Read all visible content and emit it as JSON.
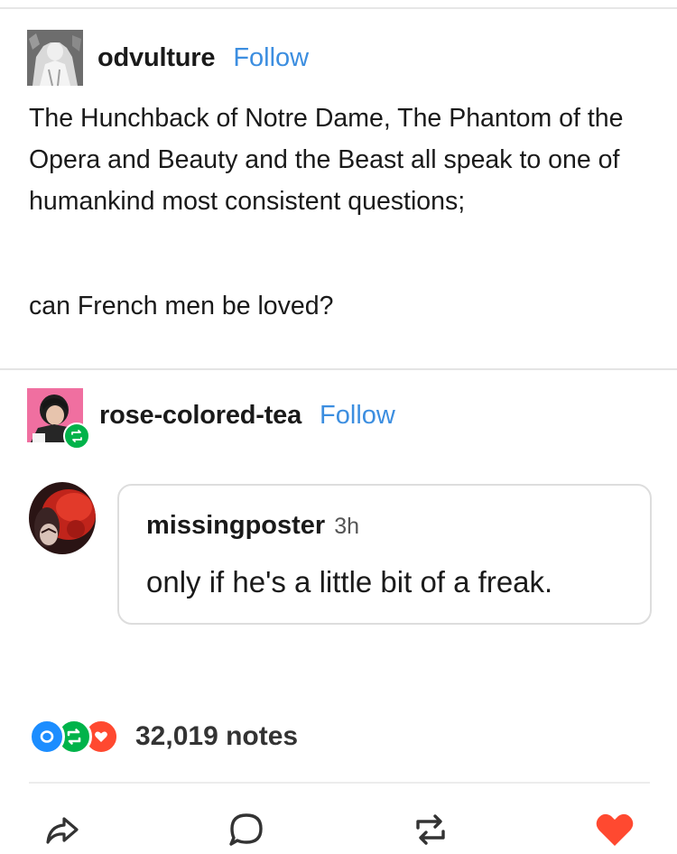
{
  "original_post": {
    "username": "odvulture",
    "follow_label": "Follow",
    "paragraphs": [
      "The Hunchback of Notre Dame, The Phantom of the Opera and Beauty and the Beast all speak to one of humankind most consistent questions;",
      "can French men be loved?"
    ]
  },
  "reblog": {
    "username": "rose-colored-tea",
    "follow_label": "Follow",
    "avatar_badge_icon": "reblog-icon"
  },
  "reply": {
    "username": "missingposter",
    "time": "3h",
    "text": "only if he's a little bit of a freak."
  },
  "notes": {
    "count_label": "32,019 notes",
    "icons": [
      "reply-note-icon",
      "reblog-note-icon",
      "like-note-icon"
    ]
  },
  "actions": {
    "icons": [
      "share-icon",
      "comment-icon",
      "reblog-icon",
      "like-heart-icon"
    ]
  },
  "colors": {
    "link_blue": "#3c8ee0",
    "reblog_green": "#00b34a",
    "like_red": "#ff4930",
    "reply_blue": "#1c8dff"
  }
}
